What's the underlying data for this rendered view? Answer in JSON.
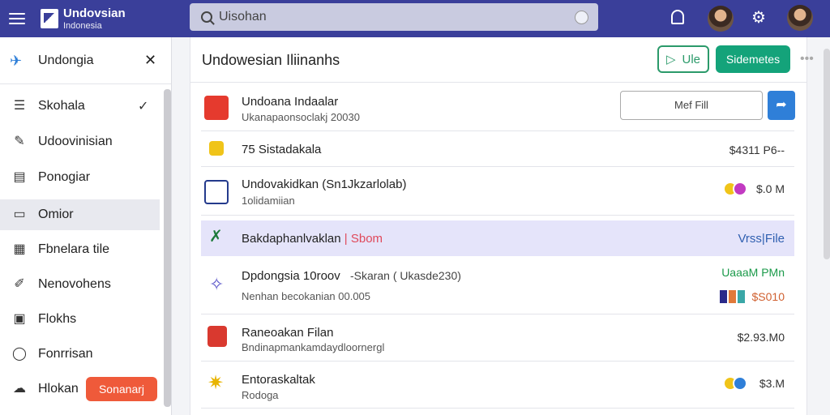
{
  "topbar": {
    "brand_title": "Undovsian",
    "brand_subtitle": "Indonesia",
    "search_placeholder": "Uisohan"
  },
  "sidebar": {
    "title": "Undongia",
    "items": [
      {
        "label": "Skohala",
        "icon": "list-icon",
        "checked": true
      },
      {
        "label": "Udoovinisian",
        "icon": "pen-icon"
      },
      {
        "label": "Ponogiar",
        "icon": "document-icon"
      },
      {
        "label": "Omior",
        "icon": "folder-icon",
        "active": true
      },
      {
        "label": "Fbnelara tile",
        "icon": "grid-icon"
      },
      {
        "label": "Nenovohens",
        "icon": "pencil-icon"
      },
      {
        "label": "Flokhs",
        "icon": "card-icon"
      },
      {
        "label": "Fonrrisan",
        "icon": "location-icon"
      },
      {
        "label": "Hlokan",
        "icon": "cloud-icon"
      }
    ],
    "action_button": "Sonanarj"
  },
  "main": {
    "title": "Undowesian Iliinanhs",
    "outline_button": "Ule",
    "primary_button": "Sidemetes",
    "rows": [
      {
        "title": "Undoana Indaalar",
        "subtitle": "Ukanapaonsoclakj 20030",
        "file_button": "Mef Fill",
        "icon": "red-envelope-icon"
      },
      {
        "title": "75 Sistadakala",
        "value": "$4311 P6--",
        "icon": "badge-icon"
      },
      {
        "title": "Undovakidkan (Sn1Jkzarlolab)",
        "subtitle": "1olidamiian",
        "value": "$.0 M",
        "icon": "app-icon"
      },
      {
        "title": "Bakdaphanlvaklan",
        "highlight": "Sbom",
        "value": "Vrss|File",
        "icon": "leaf-icon"
      },
      {
        "title": "Dpdongsia 10roov",
        "title_extra": "-Skaran ( Ukasde230)",
        "subtitle": "Nenhan becokanian 00.005",
        "value": "UaaaM PMn",
        "value2": "$S010",
        "icon": "star-icon"
      },
      {
        "title": "Raneoakan Filan",
        "subtitle": "Bndinapmankamdaydloornergl",
        "value": "$2.93.M0",
        "icon": "gift-icon"
      },
      {
        "title": "Entoraskaltak",
        "subtitle": "Rodoga",
        "value": "$3.M",
        "icon": "sparkle-icon"
      }
    ]
  },
  "colors": {
    "topbar": "#3a3f9a",
    "accent_green": "#14a37a",
    "accent_blue": "#2f7fd8",
    "accent_orange": "#ef5a3a",
    "highlight_row": "#e5e4fa"
  }
}
